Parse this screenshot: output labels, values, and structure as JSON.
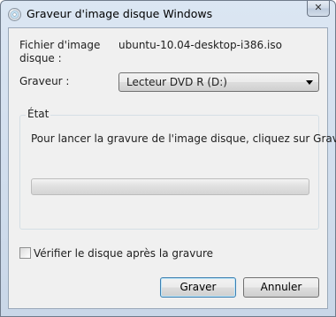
{
  "window": {
    "title": "Graveur d'image disque Windows",
    "close_glyph": "✕",
    "icon": "disc-burner-icon"
  },
  "form": {
    "file_label": "Fichier d'image disque :",
    "file_value": "ubuntu-10.04-desktop-i386.iso",
    "burner_label": "Graveur :",
    "burner_selected": "Lecteur DVD R (D:)"
  },
  "status_group": {
    "title": "État",
    "message": "Pour lancer la gravure de l'image disque, cliquez sur Graver.",
    "progress_fraction": 0
  },
  "verify": {
    "label": "Vérifier le disque après la gravure",
    "checked": false
  },
  "buttons": {
    "burn": "Graver",
    "cancel": "Annuler"
  }
}
